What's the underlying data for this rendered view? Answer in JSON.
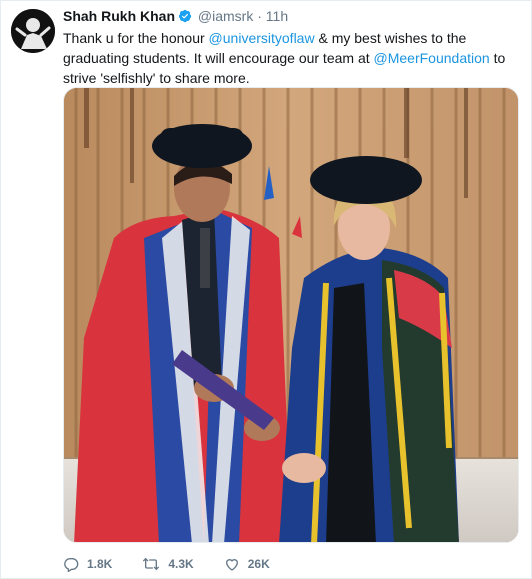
{
  "tweet": {
    "author": {
      "display_name": "Shah Rukh Khan",
      "handle": "@iamsrk",
      "separator": "·",
      "time": "11h"
    },
    "text": {
      "part1": "Thank u for the honour ",
      "mention1": "@universityoflaw",
      "part2": " & my best wishes to the graduating students. It will encourage our team at ",
      "mention2": "@MeerFoundation",
      "part3": " to strive 'selfishly' to share more."
    },
    "actions": {
      "replies": "1.8K",
      "retweets": "4.3K",
      "likes": "26K"
    }
  },
  "colors": {
    "link": "#1b95e0",
    "secondary_text": "#657786",
    "verified": "#1da1f2"
  },
  "icons": {
    "verified": "verified-badge-icon",
    "reply": "reply-icon",
    "retweet": "retweet-icon",
    "like": "heart-icon"
  }
}
